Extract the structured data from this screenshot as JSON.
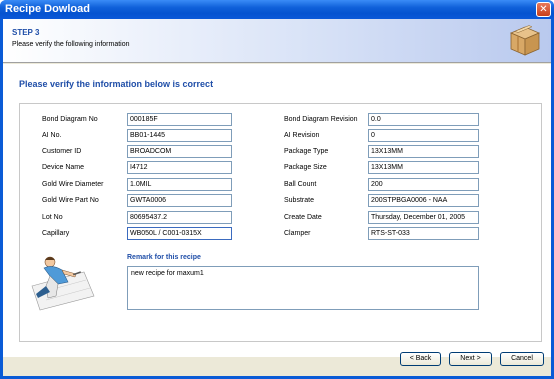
{
  "window": {
    "title": "Recipe Dowload",
    "close_glyph": "✕"
  },
  "header": {
    "step": "STEP 3",
    "subtitle": "Please verify the following information",
    "icon": "box-icon"
  },
  "main": {
    "heading": "Please verify the information below is correct",
    "left_fields": [
      {
        "label": "Bond Diagram No",
        "value": "000185F"
      },
      {
        "label": "AI No.",
        "value": "BB01-1445"
      },
      {
        "label": "Customer ID",
        "value": "BROADCOM"
      },
      {
        "label": "Device Name",
        "value": "I4712"
      },
      {
        "label": "Gold Wire Diameter",
        "value": "1.0MIL"
      },
      {
        "label": "Gold Wire Part No",
        "value": "GWTA0006"
      },
      {
        "label": "Lot No",
        "value": "80695437.2"
      },
      {
        "label": "Capillary",
        "value": "WB050L / C001-0315X"
      }
    ],
    "right_fields": [
      {
        "label": "Bond Diagram Revision",
        "value": "0.0"
      },
      {
        "label": "AI Revision",
        "value": "0"
      },
      {
        "label": "Package Type",
        "value": "13X13MM"
      },
      {
        "label": "Package Size",
        "value": "13X13MM"
      },
      {
        "label": "Ball Count",
        "value": "200"
      },
      {
        "label": "Substrate",
        "value": "200STPBGA0006 - NAA"
      },
      {
        "label": "Create Date",
        "value": "Thursday, December 01, 2005"
      },
      {
        "label": "Clamper",
        "value": "RTS-ST-033"
      }
    ],
    "remark": {
      "label": "Remark for this recipe",
      "value": "new recipe for maxum1"
    }
  },
  "buttons": {
    "back": "< Back",
    "next": "Next >",
    "cancel": "Cancel"
  },
  "colors": {
    "accent": "#1f4ea8",
    "titlebar": "#0a5bd6"
  }
}
